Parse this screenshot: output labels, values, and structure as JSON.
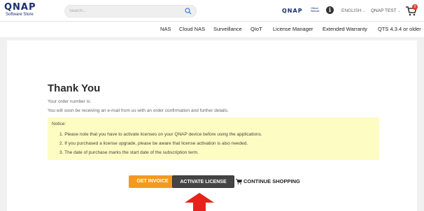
{
  "header": {
    "logo": "QNAP",
    "logo_sub": "Software Store",
    "search_placeholder": "Search...",
    "brand": "QNAP",
    "brand_note": "Official Website",
    "language": "ENGLISH",
    "user": "QNAP TEST",
    "cart_count": "0"
  },
  "nav": {
    "items": [
      "NAS",
      "Cloud NAS",
      "Surveillance",
      "QIoT",
      "License Manager",
      "Extended Warranty",
      "QTS 4.3.4 or older"
    ]
  },
  "content": {
    "title": "Thank You",
    "order_line": "Your order number is:",
    "email_line": "You will soon be receiving an e-mail from us with an order confirmation and further details.",
    "notice_title": "Notice:",
    "notice_items": [
      "1. Please note that you have to activate licenses on your QNAP device before using the applications.",
      "2. If you purchased a license upgrade, please be aware that license activation is also needed.",
      "3. The date of purchase marks the start date of the subscription term."
    ]
  },
  "actions": {
    "invoice": "GET INVOICE",
    "activate": "ACTIVATE LICENSE",
    "continue": "CONTINUE SHOPPING"
  },
  "colors": {
    "accent_orange": "#f39a1d",
    "dark_button": "#444444",
    "notice_bg": "#fdfcc3",
    "arrow_red": "#e5231b"
  }
}
